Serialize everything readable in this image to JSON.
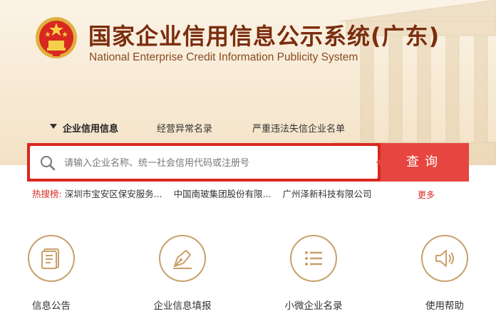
{
  "header": {
    "title_cn": "国家企业信用信息公示系统(广东)",
    "title_en": "National Enterprise Credit Information Publicity System"
  },
  "tabs": [
    {
      "label": "企业信用信息",
      "active": true
    },
    {
      "label": "经营异常名录",
      "active": false
    },
    {
      "label": "严重违法失信企业名单",
      "active": false
    }
  ],
  "search": {
    "placeholder": "请输入企业名称、统一社会信用代码或注册号",
    "button_label": "查询"
  },
  "hot_search": {
    "label": "热搜榜:",
    "items": [
      "深圳市宝安区保安服务...",
      "中国南玻集团股份有限...",
      "广州泽新科技有限公司"
    ],
    "more_label": "更多"
  },
  "services": [
    {
      "label": "信息公告",
      "icon": "document-icon"
    },
    {
      "label": "企业信息填报",
      "icon": "pen-icon"
    },
    {
      "label": "小微企业名录",
      "icon": "list-icon"
    },
    {
      "label": "使用帮助",
      "icon": "speaker-icon"
    }
  ],
  "colors": {
    "brand_red": "#d8281f",
    "button_red": "#e64540",
    "title_brown": "#7b2d0e",
    "gold": "#c9a06a"
  }
}
